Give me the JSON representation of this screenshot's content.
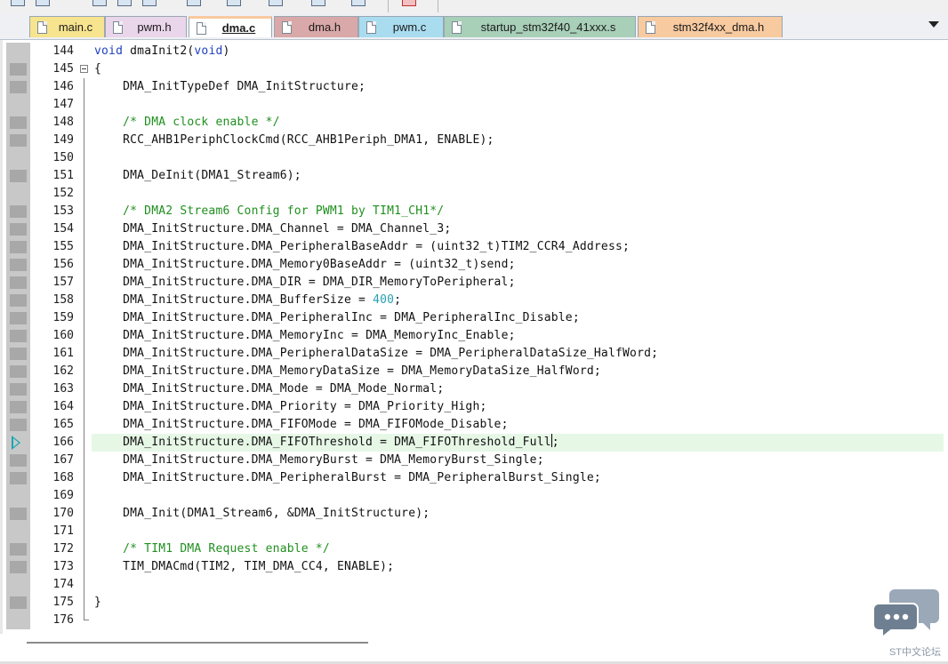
{
  "tabs": [
    {
      "label": "main.c",
      "color": "#f6e48f",
      "active": false
    },
    {
      "label": "pwm.h",
      "color": "#ead6ea",
      "active": false
    },
    {
      "label": "dma.c",
      "color": "#f8caa0",
      "active": true
    },
    {
      "label": "dma.h",
      "color": "#d9a8a8",
      "active": false
    },
    {
      "label": "pwm.c",
      "color": "#a9dcef",
      "active": false
    },
    {
      "label": "startup_stm32f40_41xxx.s",
      "color": "#a8cfb8",
      "active": false
    },
    {
      "label": "stm32f4xx_dma.h",
      "color": "#f8caa0",
      "active": false
    }
  ],
  "editor": {
    "current_line": "166",
    "lines": [
      {
        "no": "144",
        "text": "void dmaInit2(void)"
      },
      {
        "no": "145",
        "text": "{"
      },
      {
        "no": "146",
        "text": "    DMA_InitTypeDef DMA_InitStructure;"
      },
      {
        "no": "147",
        "text": ""
      },
      {
        "no": "148",
        "text": "    /* DMA clock enable */"
      },
      {
        "no": "149",
        "text": "    RCC_AHB1PeriphClockCmd(RCC_AHB1Periph_DMA1, ENABLE);"
      },
      {
        "no": "150",
        "text": ""
      },
      {
        "no": "151",
        "text": "    DMA_DeInit(DMA1_Stream6);"
      },
      {
        "no": "152",
        "text": ""
      },
      {
        "no": "153",
        "text": "    /* DMA2 Stream6 Config for PWM1 by TIM1_CH1*/"
      },
      {
        "no": "154",
        "text": "    DMA_InitStructure.DMA_Channel = DMA_Channel_3;"
      },
      {
        "no": "155",
        "text": "    DMA_InitStructure.DMA_PeripheralBaseAddr = (uint32_t)TIM2_CCR4_Address;"
      },
      {
        "no": "156",
        "text": "    DMA_InitStructure.DMA_Memory0BaseAddr = (uint32_t)send;"
      },
      {
        "no": "157",
        "text": "    DMA_InitStructure.DMA_DIR = DMA_DIR_MemoryToPeripheral;"
      },
      {
        "no": "158",
        "text": "    DMA_InitStructure.DMA_BufferSize = 400;"
      },
      {
        "no": "159",
        "text": "    DMA_InitStructure.DMA_PeripheralInc = DMA_PeripheralInc_Disable;"
      },
      {
        "no": "160",
        "text": "    DMA_InitStructure.DMA_MemoryInc = DMA_MemoryInc_Enable;"
      },
      {
        "no": "161",
        "text": "    DMA_InitStructure.DMA_PeripheralDataSize = DMA_PeripheralDataSize_HalfWord;"
      },
      {
        "no": "162",
        "text": "    DMA_InitStructure.DMA_MemoryDataSize = DMA_MemoryDataSize_HalfWord;"
      },
      {
        "no": "163",
        "text": "    DMA_InitStructure.DMA_Mode = DMA_Mode_Normal;"
      },
      {
        "no": "164",
        "text": "    DMA_InitStructure.DMA_Priority = DMA_Priority_High;"
      },
      {
        "no": "165",
        "text": "    DMA_InitStructure.DMA_FIFOMode = DMA_FIFOMode_Disable;"
      },
      {
        "no": "166",
        "text": "    DMA_InitStructure.DMA_FIFOThreshold = DMA_FIFOThreshold_Full;"
      },
      {
        "no": "167",
        "text": "    DMA_InitStructure.DMA_MemoryBurst = DMA_MemoryBurst_Single;"
      },
      {
        "no": "168",
        "text": "    DMA_InitStructure.DMA_PeripheralBurst = DMA_PeripheralBurst_Single;"
      },
      {
        "no": "169",
        "text": ""
      },
      {
        "no": "170",
        "text": "    DMA_Init(DMA1_Stream6, &DMA_InitStructure);"
      },
      {
        "no": "171",
        "text": ""
      },
      {
        "no": "172",
        "text": "    /* TIM1 DMA Request enable */"
      },
      {
        "no": "173",
        "text": "    TIM_DMACmd(TIM2, TIM_DMA_CC4, ENABLE);"
      },
      {
        "no": "174",
        "text": ""
      },
      {
        "no": "175",
        "text": "}"
      },
      {
        "no": "176",
        "text": ""
      }
    ]
  },
  "watermark": {
    "text": "ST中文论坛"
  },
  "icons": {
    "tab_file": "file-icon",
    "tab_menu": "chevron-down-icon",
    "execution_marker": "current-line-arrow-icon",
    "watermark_logo": "chat-bubbles-icon"
  },
  "colors": {
    "keyword": "#1f3fbf",
    "comment": "#1f8f1f",
    "number": "#2aa0b0",
    "current_line": "#e6f7e6"
  }
}
